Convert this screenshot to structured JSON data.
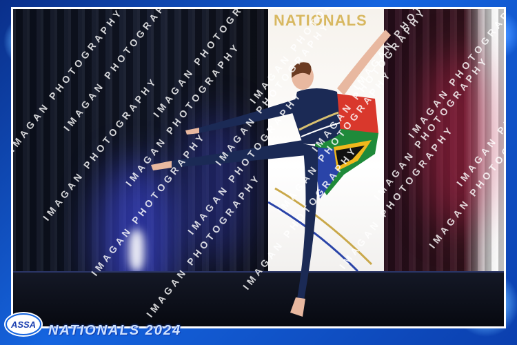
{
  "banner": {
    "title": "NATIONALS"
  },
  "logo": {
    "text": "ASSA"
  },
  "event": {
    "title": "NATIONALS 2024"
  },
  "watermark": {
    "text": "IMAGAN PHOTOGRAPHY"
  },
  "colors": {
    "frame_blue": "#1565e0",
    "banner_gold": "#d8b860",
    "leotard_navy": "#1b2a55",
    "flag_green": "#1f8a3a",
    "flag_red": "#d9382c",
    "flag_blue": "#2a44a8",
    "flag_gold": "#f0b81c"
  }
}
